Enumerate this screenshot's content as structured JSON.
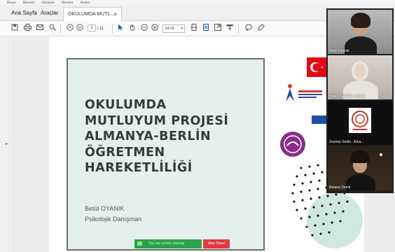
{
  "menu": {
    "items": [
      "Dosya",
      "Düzenle",
      "Görünüm",
      "Pencere",
      "Yardım"
    ]
  },
  "tabs": {
    "home": "Ana Sayfa",
    "tools": "Araçlar",
    "doc": "OKULUMDA MUTL...",
    "close": "×"
  },
  "toolbar": {
    "page_current": "1",
    "page_total": "/ 11",
    "zoom": "54,03"
  },
  "slide": {
    "title_lines": [
      "OKULUMDA",
      "MUTLUYUM PROJESİ",
      "ALMANYA-BERLİN",
      "ÖĞRETMEN",
      "HAREKETLİLİĞİ"
    ],
    "author": "Betül OYANIK",
    "role": "Psikolojik Danışman"
  },
  "share": {
    "status": "You are screen sharing",
    "stop": "Stop Share"
  },
  "participants": [
    {
      "name": "Betül Oyanık"
    },
    {
      "name": "Hatice ŞEKER- Ankara"
    },
    {
      "name": "Zeynep Sedla - Arka..."
    },
    {
      "name": "Betane Demir"
    }
  ],
  "colors": {
    "slide_bg": "#e5f0ec",
    "title": "#3a3a3a",
    "share_green": "#2ba24b",
    "stop_red": "#e0393e",
    "flag_red": "#e30a17"
  }
}
